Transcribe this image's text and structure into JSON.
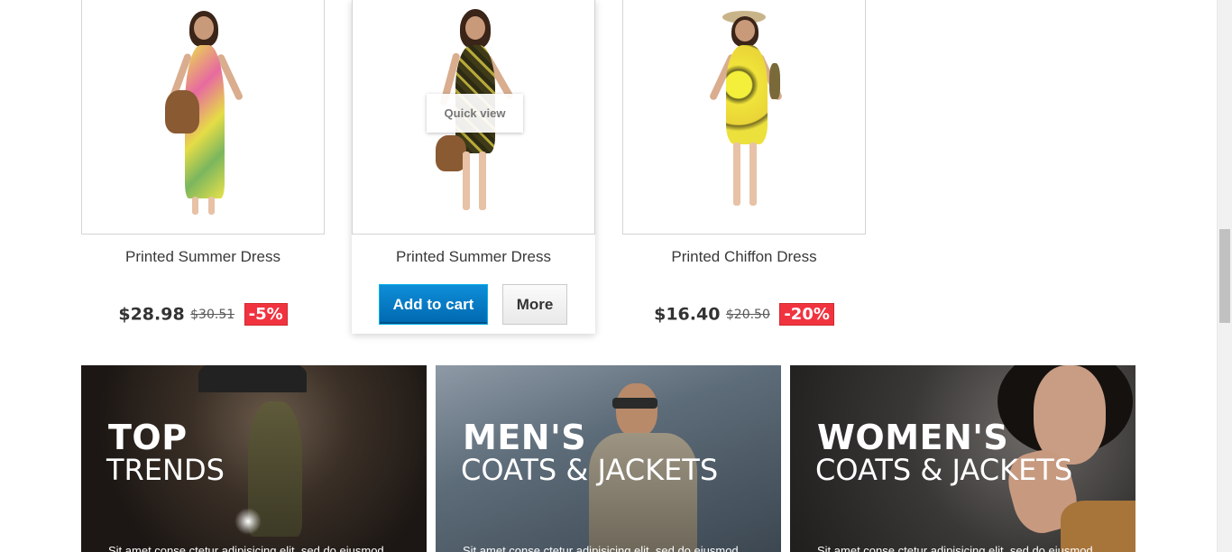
{
  "products": [
    {
      "name": "Printed Summer Dress",
      "price": "$28.98",
      "old_price": "$30.51",
      "discount": "-5%"
    },
    {
      "name": "Printed Summer Dress",
      "quick_view": "Quick view",
      "add_to_cart": "Add to cart",
      "more": "More"
    },
    {
      "name": "Printed Chiffon Dress",
      "price": "$16.40",
      "old_price": "$20.50",
      "discount": "-20%"
    }
  ],
  "banners": [
    {
      "title_strong": "TOP",
      "title_light": "TRENDS",
      "desc": "Sit amet conse ctetur adipisicing elit, sed do eiusmod"
    },
    {
      "title_strong": "MEN'S",
      "title_light": "COATS & JACKETS",
      "desc": "Sit amet conse ctetur adipisicing elit, sed do eiusmod"
    },
    {
      "title_strong": "WOMEN'S",
      "title_light": "COATS & JACKETS",
      "desc": "Sit amet conse ctetur adipisicing elit, sed do eiusmod"
    }
  ],
  "colors": {
    "accent_blue": "#0e8ed8",
    "discount_red": "#f13340"
  }
}
